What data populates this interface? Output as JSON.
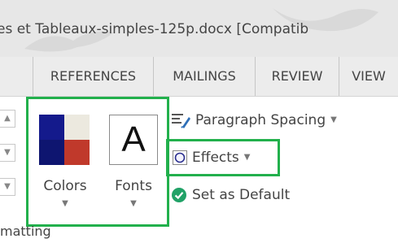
{
  "window": {
    "title": "es et Tableaux-simples-125p.docx [Compatib"
  },
  "tabs": [
    {
      "label": ""
    },
    {
      "label": "REFERENCES"
    },
    {
      "label": "MAILINGS"
    },
    {
      "label": "REVIEW"
    },
    {
      "label": "VIEW"
    }
  ],
  "ribbon": {
    "colors_label": "Colors",
    "fonts_label": "Fonts",
    "fonts_glyph": "A",
    "paragraph_spacing_label": "Paragraph Spacing",
    "effects_label": "Effects",
    "set_default_label": "Set as Default",
    "group_label": "matting",
    "colors_swatch": {
      "top_left": "#141a8c",
      "top_right": "#ece9df",
      "bottom_left": "#0e1570",
      "bottom_right": "#c0392b"
    }
  },
  "colors": {
    "highlight": "#22b04c",
    "checkmark": "#21a267"
  }
}
